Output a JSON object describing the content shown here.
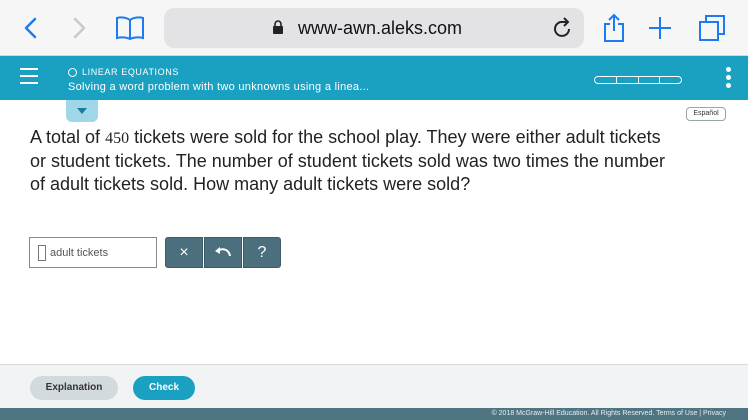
{
  "browser": {
    "url": "www-awn.aleks.com",
    "icons": [
      "back-icon",
      "forward-icon",
      "bookmarks-icon",
      "lock-icon",
      "reload-icon",
      "share-icon",
      "new-tab-icon",
      "tabs-icon"
    ]
  },
  "header": {
    "topic": "LINEAR EQUATIONS",
    "title": "Solving a word problem with two unknowns using a linea..."
  },
  "lang_button": "Español",
  "question": {
    "part1": "A total of ",
    "number": "450",
    "part2": " tickets were sold for the school play. They were either adult tickets or student tickets. The number of student tickets sold was two times the number of adult tickets sold. How many adult tickets were sold?"
  },
  "answer": {
    "value": "",
    "unit": "adult tickets"
  },
  "tools": {
    "clear": "×",
    "help": "?"
  },
  "footer": {
    "explanation": "Explanation",
    "check": "Check"
  },
  "copyright": "© 2018 McGraw-Hill Education. All Rights Reserved.   Terms of Use   |   Privacy",
  "colors": {
    "accent": "#1aa1c2",
    "tool": "#4b6f7d",
    "footer_bar": "#4f7583"
  }
}
